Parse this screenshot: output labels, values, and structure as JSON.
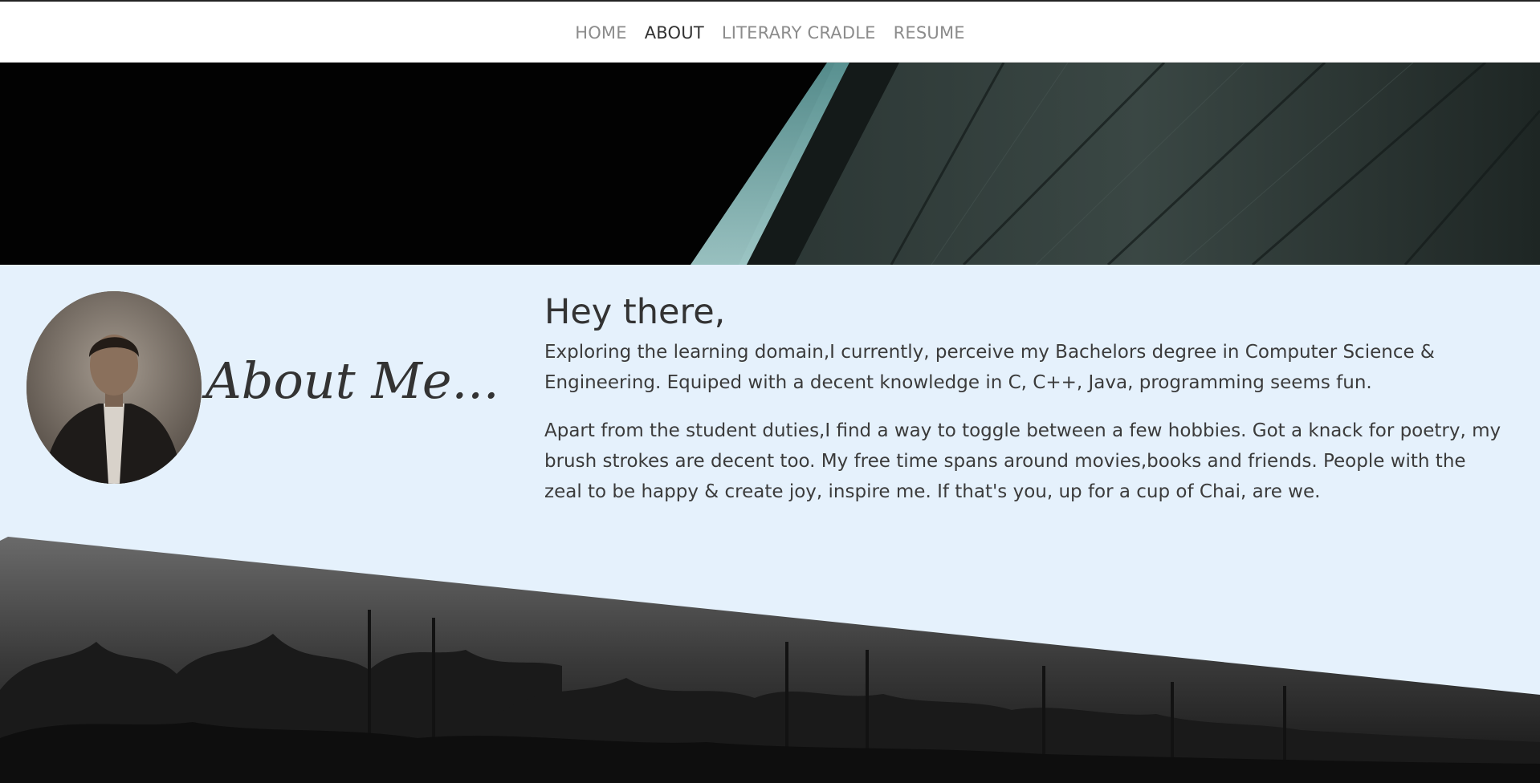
{
  "nav": {
    "items": [
      {
        "label": "HOME",
        "active": false
      },
      {
        "label": "ABOUT",
        "active": true
      },
      {
        "label": "LITERARY CRADLE",
        "active": false
      },
      {
        "label": "RESUME",
        "active": false
      }
    ]
  },
  "about": {
    "title": "About Me...",
    "greeting": "Hey there,",
    "paragraphs": [
      "Exploring the learning domain,I currently, perceive my Bachelors degree in Computer Science & Engineering. Equiped with a decent knowledge in C, C++, Java, programming seems fun.",
      "Apart from the student duties,I find a way to toggle between a few hobbies. Got a knack for poetry, my brush strokes are decent too. My free time spans around movies,books and friends. People with the zeal to be happy & create joy, inspire me. If that's you, up for a cup of Chai, are we."
    ]
  },
  "colors": {
    "about_background": "#e5f1fc",
    "nav_active": "#333333",
    "nav_inactive": "#8c8c8c"
  }
}
